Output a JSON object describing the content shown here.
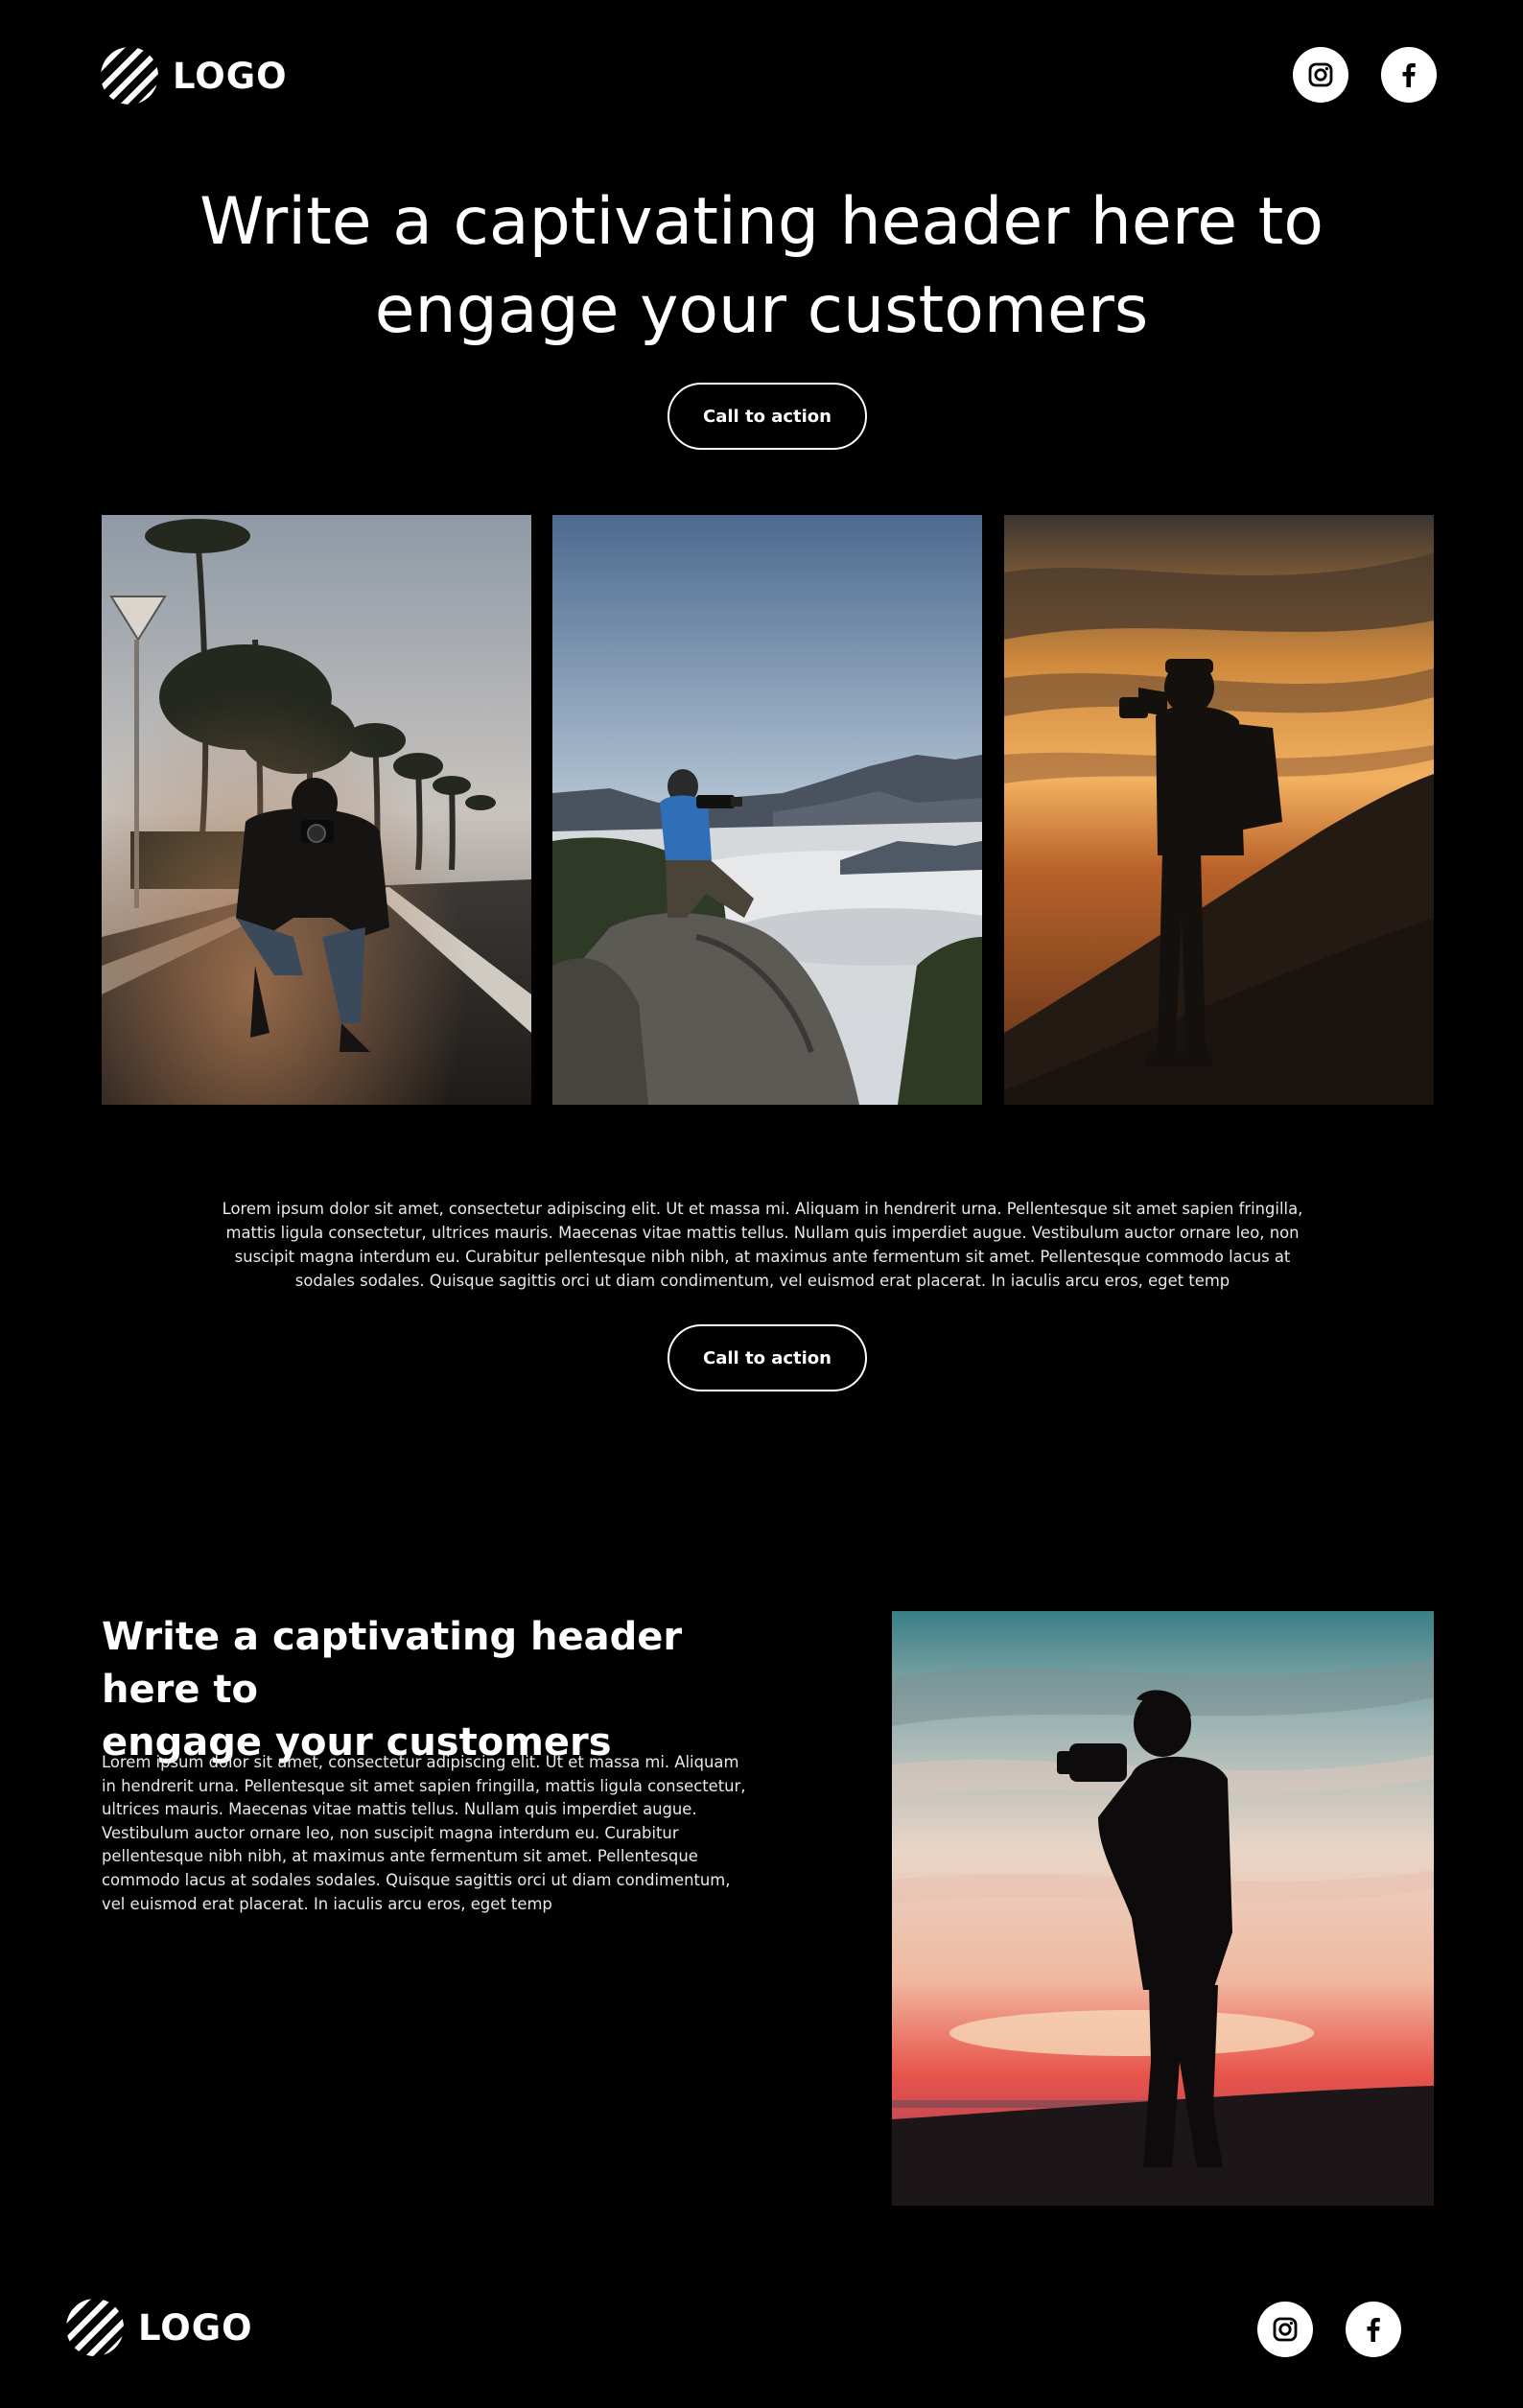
{
  "header": {
    "logo_text": "LOGO",
    "social": [
      {
        "icon": "instagram-icon"
      },
      {
        "icon": "facebook-icon"
      }
    ]
  },
  "hero": {
    "title_line1": "Write a captivating header here to",
    "title_line2": "engage your customers",
    "cta_label": "Call to action"
  },
  "gallery": [
    {
      "name": "photographer-on-road-photo"
    },
    {
      "name": "photographer-on-mountain-photo"
    },
    {
      "name": "photographer-sunset-silhouette-photo"
    }
  ],
  "body": {
    "paragraph": "Lorem ipsum dolor sit amet, consectetur adipiscing elit. Ut et massa mi. Aliquam in hendrerit urna. Pellentesque sit amet sapien fringilla, mattis ligula consectetur, ultrices mauris. Maecenas vitae mattis tellus. Nullam quis imperdiet augue. Vestibulum auctor ornare leo, non suscipit magna interdum eu. Curabitur pellentesque nibh nibh, at maximus ante fermentum sit amet. Pellentesque commodo lacus at sodales sodales. Quisque sagittis orci ut diam condimentum, vel euismod erat placerat. In iaculis arcu eros, eget temp",
    "cta_label": "Call to action"
  },
  "feature": {
    "title_line1": "Write a captivating header here to",
    "title_line2": "engage your customers",
    "paragraph": "Lorem ipsum dolor sit amet, consectetur adipiscing elit. Ut et massa mi. Aliquam in hendrerit urna. Pellentesque sit amet sapien fringilla, mattis ligula consectetur, ultrices mauris. Maecenas vitae mattis tellus. Nullam quis imperdiet augue. Vestibulum auctor ornare leo, non suscipit magna interdum eu. Curabitur pellentesque nibh nibh, at maximus ante fermentum sit amet. Pellentesque commodo lacus at sodales sodales. Quisque sagittis orci ut diam condimentum, vel euismod erat placerat. In iaculis arcu eros, eget temp"
  },
  "footer": {
    "logo_text": "LOGO"
  },
  "colors": {
    "background": "#000000",
    "text": "#ffffff"
  }
}
